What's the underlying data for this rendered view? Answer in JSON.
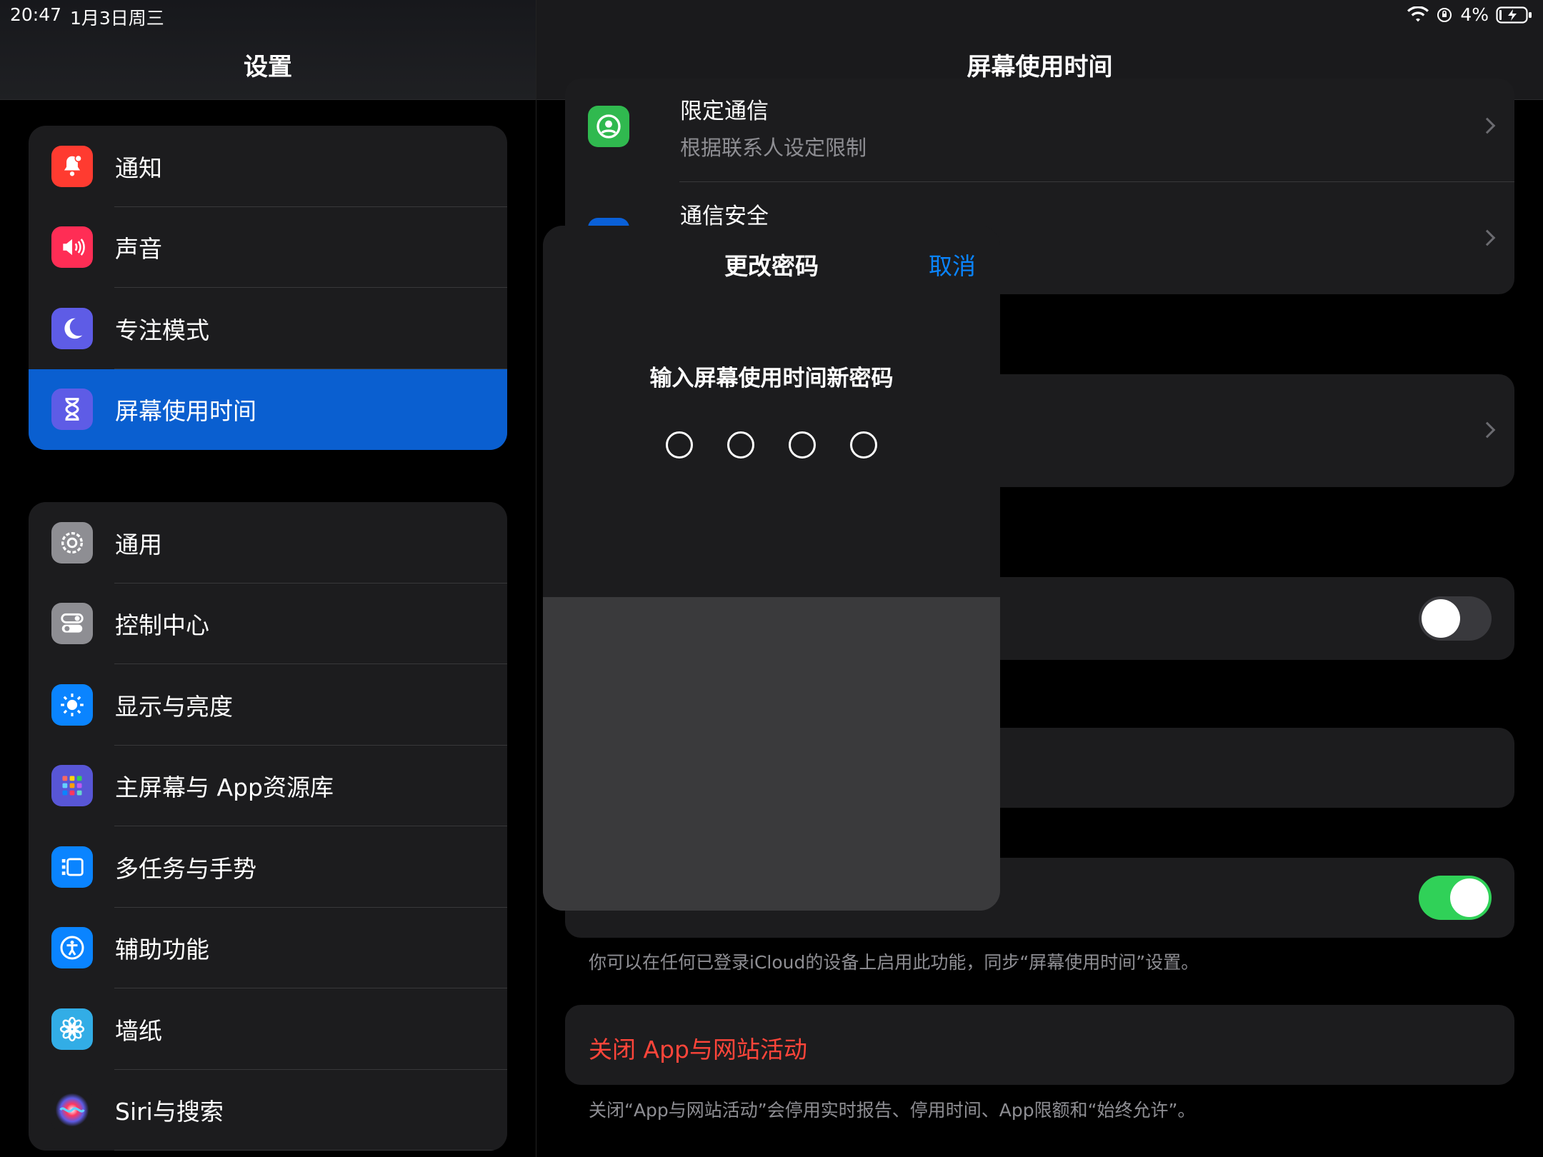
{
  "status": {
    "time": "20:47",
    "date": "1月3日周三",
    "battery": "4%"
  },
  "sidebar": {
    "title": "设置",
    "group1": [
      {
        "label": "通知",
        "icon": "bell-icon",
        "color": "#ff3b30"
      },
      {
        "label": "声音",
        "icon": "speaker-icon",
        "color": "#ff2d55"
      },
      {
        "label": "专注模式",
        "icon": "moon-icon",
        "color": "#5e5ce6"
      },
      {
        "label": "屏幕使用时间",
        "icon": "hourglass-icon",
        "color": "#5e5ce6",
        "selected": true
      }
    ],
    "group2": [
      {
        "label": "通用",
        "icon": "gear-icon",
        "color": "#8e8e93"
      },
      {
        "label": "控制中心",
        "icon": "toggles-icon",
        "color": "#8e8e93"
      },
      {
        "label": "显示与亮度",
        "icon": "sun-icon",
        "color": "#0a84ff"
      },
      {
        "label": "主屏幕与 App资源库",
        "icon": "grid-icon",
        "color": "#5856d6"
      },
      {
        "label": "多任务与手势",
        "icon": "multitask-icon",
        "color": "#0a84ff"
      },
      {
        "label": "辅助功能",
        "icon": "accessibility-icon",
        "color": "#0a84ff"
      },
      {
        "label": "墙纸",
        "icon": "flower-icon",
        "color": "#32ade6"
      },
      {
        "label": "Siri与搜索",
        "icon": "siri-icon",
        "color": "#1c1c1e"
      }
    ]
  },
  "detail": {
    "title": "屏幕使用时间",
    "row_limit_title": "限定通信",
    "row_limit_sub": "根据联系人设定限制",
    "row_safety_title": "通信安全",
    "share_note": "你可以在任何已登录iCloud的设备上启用此功能，同步“屏幕使用时间”设置。",
    "turn_off_label": "关闭 App与网站活动",
    "turn_off_note": "关闭“App与网站活动”会停用实时报告、停用时间、App限额和“始终允许”。"
  },
  "modal": {
    "title": "更改密码",
    "cancel": "取消",
    "prompt": "输入屏幕使用时间新密码"
  },
  "colors": {
    "accent": "#0a84ff",
    "selected_row": "#0a5fd0",
    "toggle_on": "#30d158",
    "destructive": "#ff453a"
  }
}
